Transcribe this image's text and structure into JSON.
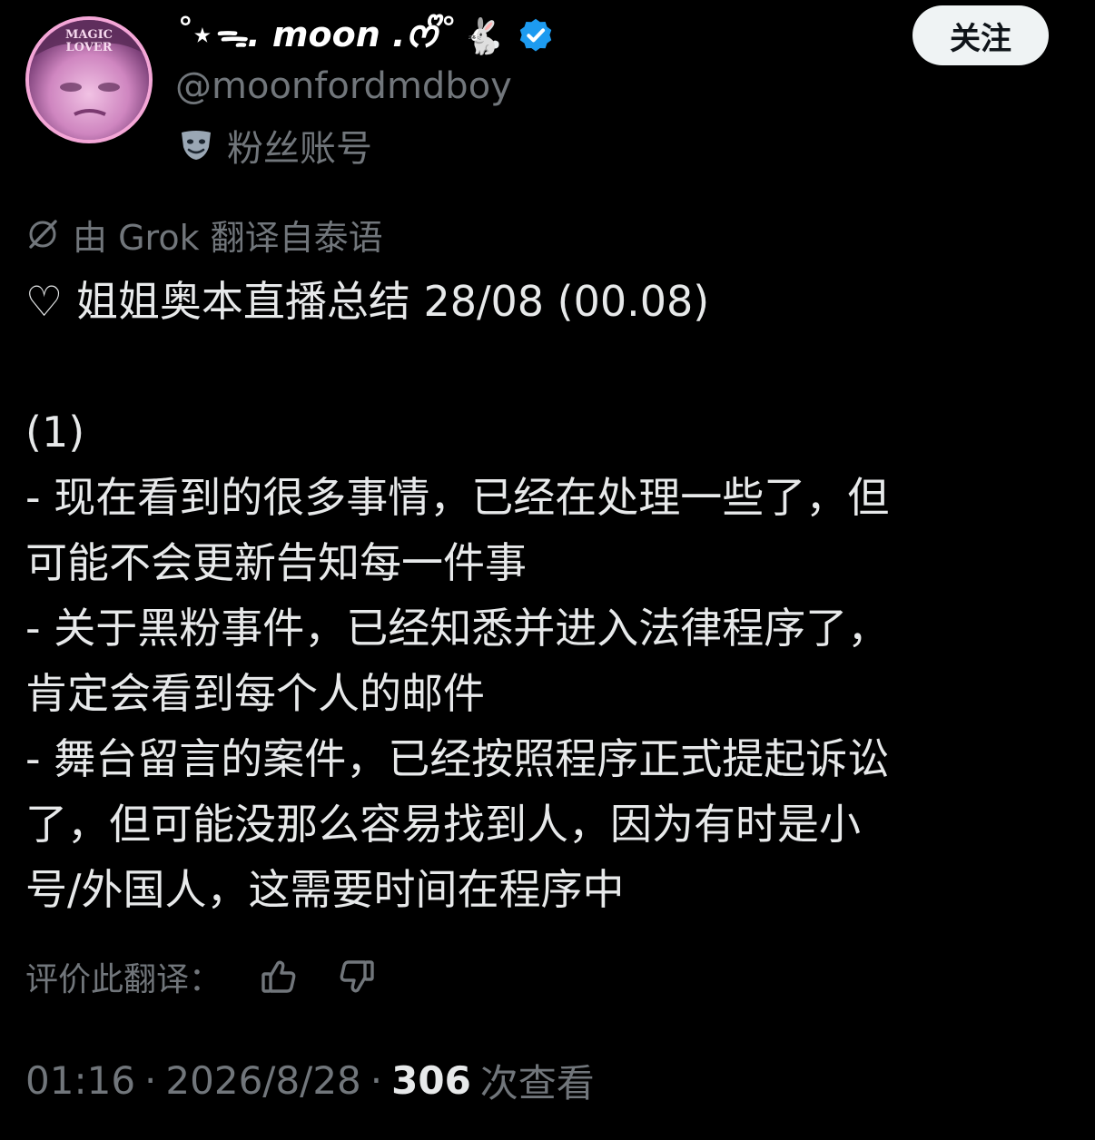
{
  "author": {
    "display_name": "˚⋆ᯓ. moon .ᰔᩚ˚",
    "display_emoji": "🐇",
    "handle": "@moonfordmdboy",
    "account_label": "粉丝账号",
    "avatar_text_top": "MAGIC",
    "avatar_text_bottom": "LOVER",
    "verified_icon": "verified-badge-icon",
    "verified_color": "#1d9bf0"
  },
  "follow_button": {
    "label": "关注"
  },
  "translation_note": "由 Grok 翻译自泰语",
  "tweet": {
    "lines": [
      "♡ 姐姐奥本直播总结 28/08 (00.08)",
      "",
      "(1)",
      "- 现在看到的很多事情，已经在处理一些了，但",
      "可能不会更新告知每一件事",
      "- 关于黑粉事件，已经知悉并进入法律程序了，",
      "肯定会看到每个人的邮件",
      "- 舞台留言的案件，已经按照程序正式提起诉讼",
      "了，但可能没那么容易找到人，因为有时是小",
      "号/外国人，这需要时间在程序中"
    ]
  },
  "rate_translation": {
    "label": "评价此翻译：",
    "up_icon": "thumbs-up-icon",
    "down_icon": "thumbs-down-icon"
  },
  "meta": {
    "time": "01:16",
    "separator": "·",
    "date": "2026/8/28",
    "views_count": "306",
    "views_label": "次查看"
  },
  "colors": {
    "background": "#000000",
    "text_primary": "#e7e9ea",
    "text_secondary": "#71767b",
    "follow_bg": "#eff3f4",
    "avatar_border": "#f4a6d7"
  }
}
